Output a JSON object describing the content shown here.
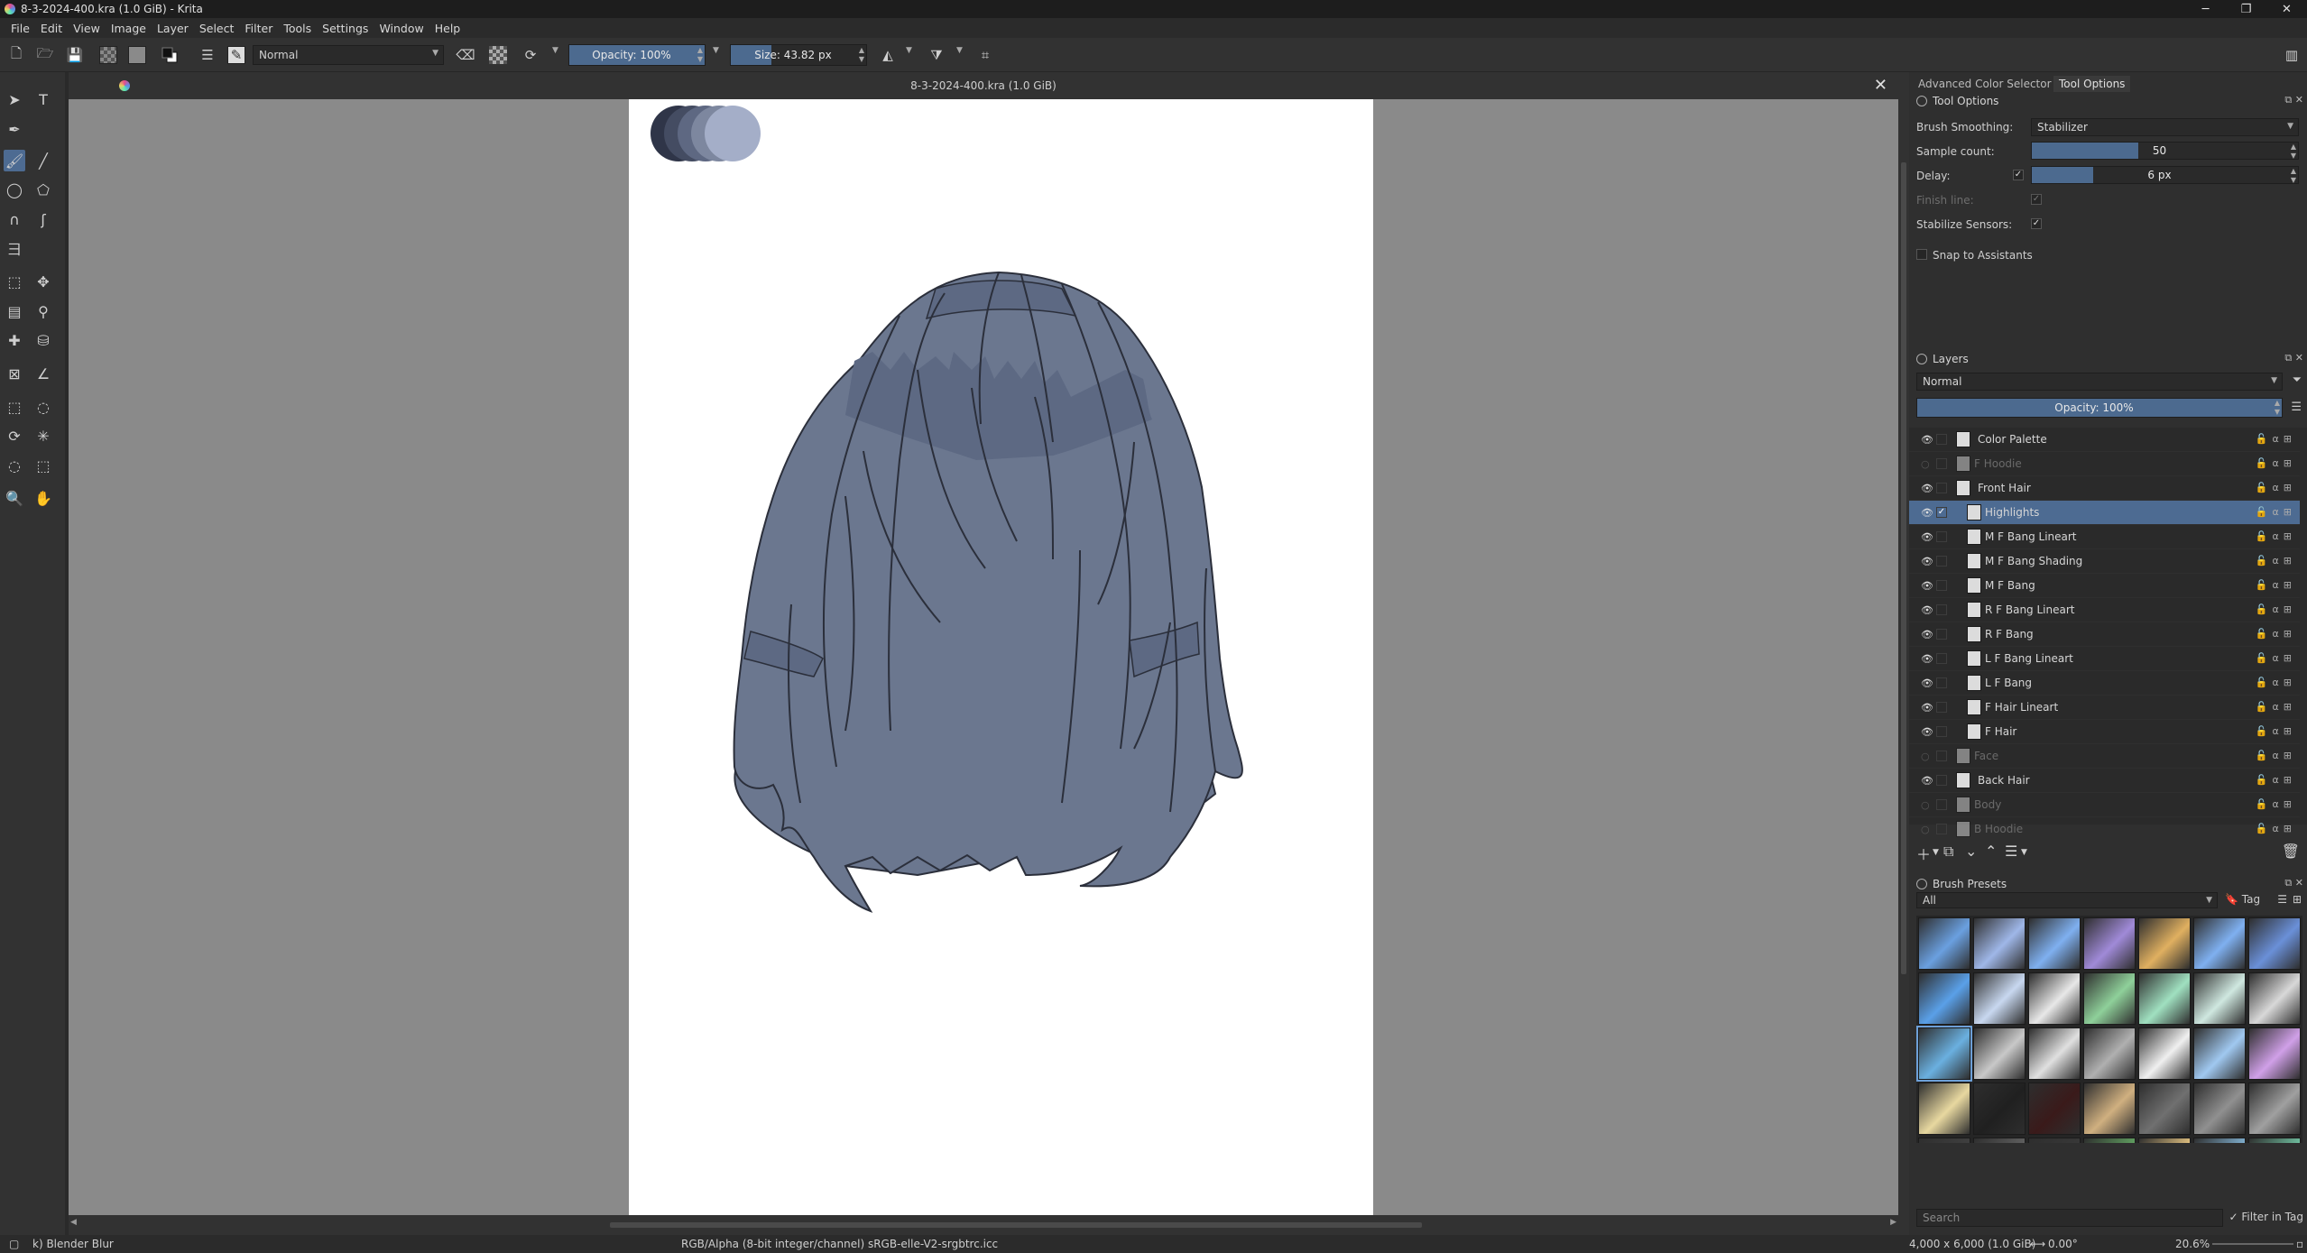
{
  "window": {
    "title": "8-3-2024-400.kra (1.0 GiB)  - Krita",
    "min": "─",
    "max": "❐",
    "close": "✕"
  },
  "menu": [
    "File",
    "Edit",
    "View",
    "Image",
    "Layer",
    "Select",
    "Filter",
    "Tools",
    "Settings",
    "Window",
    "Help"
  ],
  "toolbar": {
    "blend_mode": "Normal",
    "opacity_label": "Opacity: 100%",
    "opacity_value": 1.0,
    "size_label": "Size: 43.82 px",
    "size_value": 0.3
  },
  "document": {
    "tab_title": "8-3-2024-400.kra (1.0 GiB)",
    "close": "✕"
  },
  "dock": {
    "tabs": [
      "Advanced Color Selector",
      "Tool Options"
    ],
    "tool_options": {
      "title": "Tool Options",
      "brush_smoothing_label": "Brush Smoothing:",
      "brush_smoothing_value": "Stabilizer",
      "sample_count_label": "Sample count:",
      "sample_count_value": "50",
      "sample_count_fraction": 0.4,
      "delay_label": "Delay:",
      "delay_value": "6 px",
      "delay_fraction": 0.23,
      "finish_line_label": "Finish line:",
      "stabilize_sensors_label": "Stabilize Sensors:",
      "snap_label": "Snap to Assistants"
    },
    "layers": {
      "title": "Layers",
      "blend_mode": "Normal",
      "opacity_label": "Opacity:  100%",
      "items": [
        {
          "name": "Color Palette",
          "visible": true,
          "indent": 0,
          "group": true
        },
        {
          "name": "F Hoodie",
          "visible": false,
          "indent": 0,
          "group": false
        },
        {
          "name": "Front Hair",
          "visible": true,
          "indent": 0,
          "group": true
        },
        {
          "name": "Highlights",
          "visible": true,
          "indent": 1,
          "group": false,
          "selected": true
        },
        {
          "name": "M F Bang Lineart",
          "visible": true,
          "indent": 1,
          "group": false
        },
        {
          "name": "M F Bang Shading",
          "visible": true,
          "indent": 1,
          "group": false
        },
        {
          "name": "M F Bang",
          "visible": true,
          "indent": 1,
          "group": false
        },
        {
          "name": "R F Bang Lineart",
          "visible": true,
          "indent": 1,
          "group": false
        },
        {
          "name": "R F Bang",
          "visible": true,
          "indent": 1,
          "group": false
        },
        {
          "name": "L F Bang Lineart",
          "visible": true,
          "indent": 1,
          "group": false
        },
        {
          "name": "L F Bang",
          "visible": true,
          "indent": 1,
          "group": false
        },
        {
          "name": "F Hair Lineart",
          "visible": true,
          "indent": 1,
          "group": false
        },
        {
          "name": "F Hair",
          "visible": true,
          "indent": 1,
          "group": false
        },
        {
          "name": "Face",
          "visible": false,
          "indent": 0,
          "group": false
        },
        {
          "name": "Back Hair",
          "visible": true,
          "indent": 0,
          "group": true
        },
        {
          "name": "Body",
          "visible": false,
          "indent": 0,
          "group": false
        },
        {
          "name": "B Hoodie",
          "visible": false,
          "indent": 0,
          "group": false
        }
      ]
    },
    "brush_presets": {
      "title": "Brush Presets",
      "filter": "All",
      "tag_label": "Tag",
      "search_placeholder": "Search",
      "filter_in_tag": "Filter in Tag"
    }
  },
  "status": {
    "brush": "k) Blender Blur",
    "colorspace": "RGB/Alpha (8-bit integer/channel)  sRGB-elle-V2-srgbtrc.icc",
    "dimensions": "4,000 x 6,000 (1.0 GiB)",
    "rotation": "0.00°",
    "zoom": "20.6%"
  },
  "colors": {
    "accent": "#4d6b92",
    "hair": "#6b778f",
    "hair_dark": "#5d6983",
    "palette": [
      "#2f3548",
      "#444c62",
      "#5e6882",
      "#7d879f",
      "#a4aec8"
    ]
  }
}
